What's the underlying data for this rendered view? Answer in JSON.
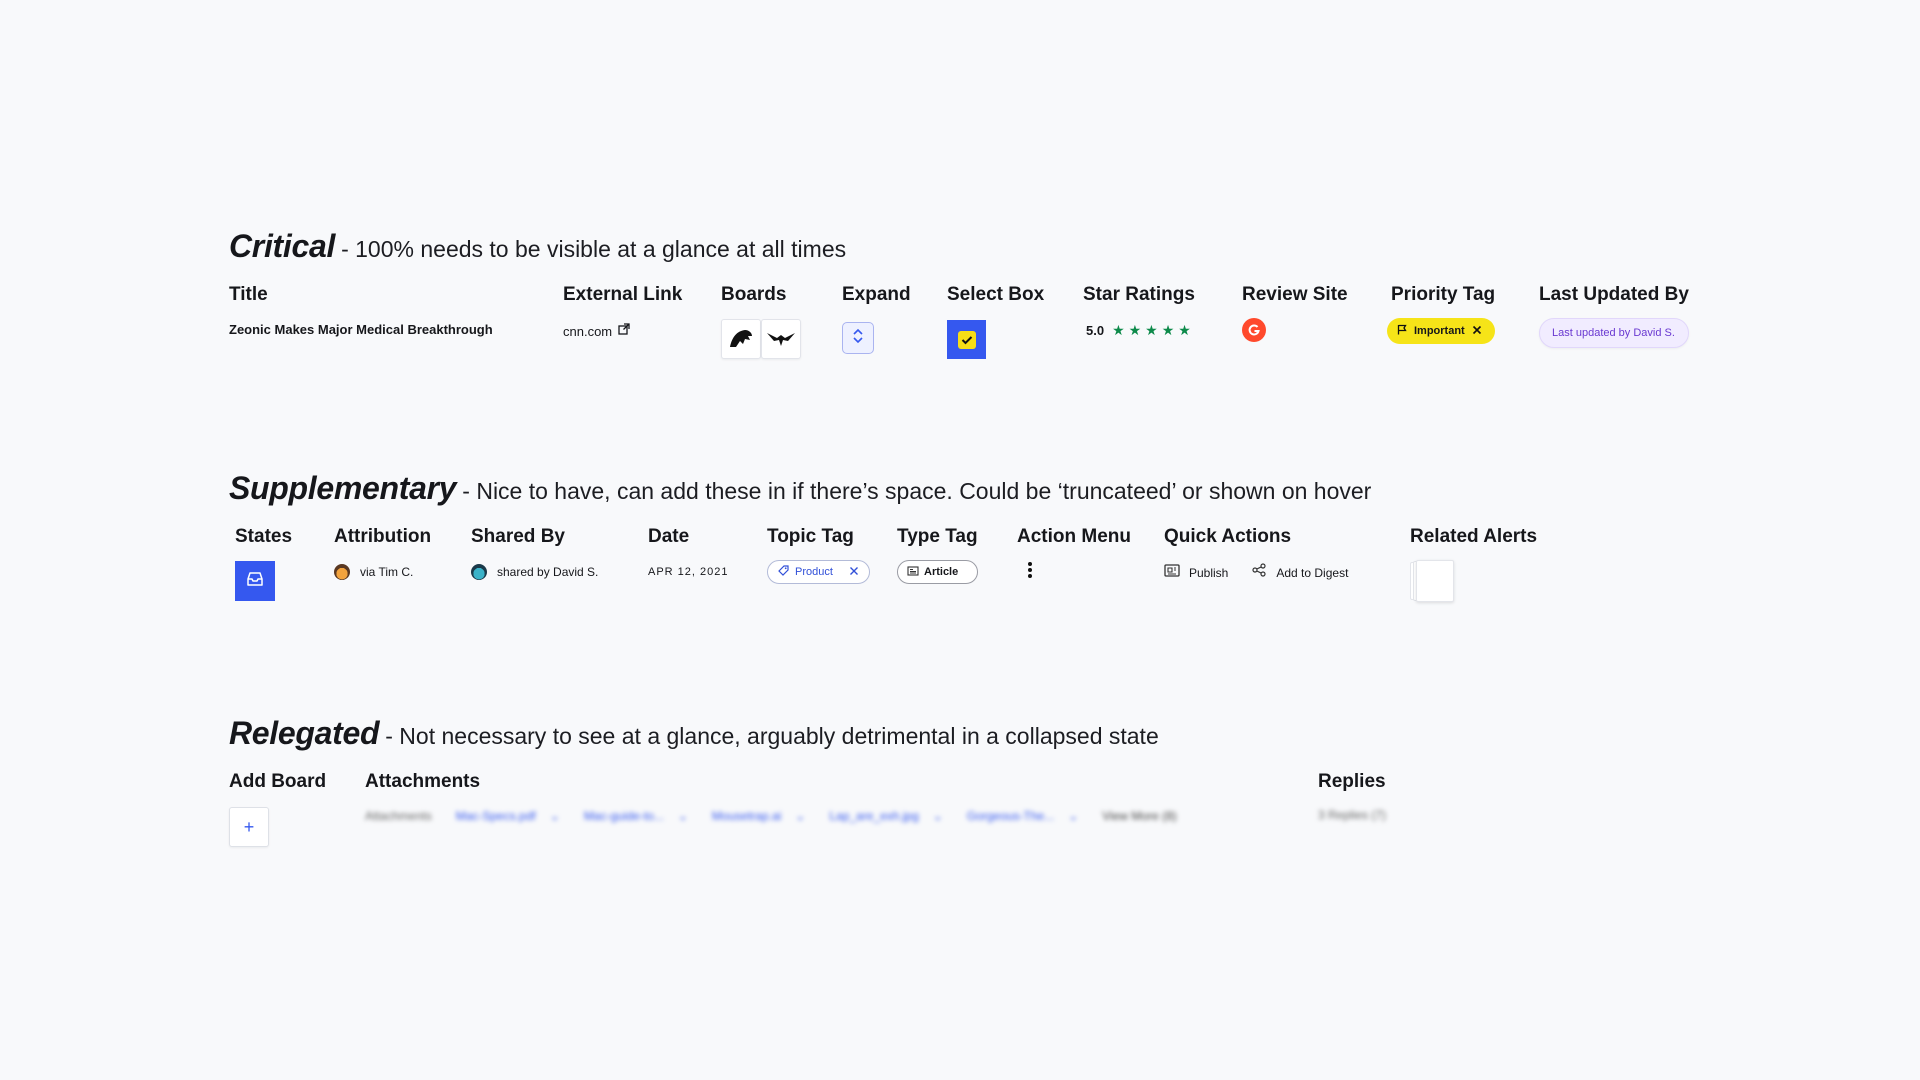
{
  "critical": {
    "title": "Critical",
    "description": "- 100% needs to be visible at a glance at all times",
    "columns": {
      "title": {
        "label": "Title",
        "value": "Zeonic Makes Major Medical Breakthrough"
      },
      "external_link": {
        "label": "External Link",
        "value": "cnn.com",
        "icon": "external-link-icon"
      },
      "boards": {
        "label": "Boards",
        "icons": [
          "lion-logo-icon",
          "eagle-logo-icon"
        ]
      },
      "expand": {
        "label": "Expand",
        "icon": "chevron-up-down-icon"
      },
      "select_box": {
        "label": "Select Box",
        "checked": true
      },
      "star_ratings": {
        "label": "Star Ratings",
        "value": "5.0",
        "stars": 5,
        "color": "#0d8a4a"
      },
      "review_site": {
        "label": "Review Site",
        "icon": "g2-logo-icon",
        "color": "#ff492c"
      },
      "priority_tag": {
        "label": "Priority Tag",
        "value": "Important",
        "color": "#f6e418"
      },
      "last_updated": {
        "label": "Last Updated By",
        "value": "Last updated by David S."
      }
    }
  },
  "supplementary": {
    "title": "Supplementary",
    "description": "- Nice to have, can add these in if there’s space. Could be ‘truncateed’ or shown on hover",
    "columns": {
      "states": {
        "label": "States",
        "icon": "inbox-icon"
      },
      "attribution": {
        "label": "Attribution",
        "value": "via Tim C."
      },
      "shared_by": {
        "label": "Shared By",
        "value": "shared by David S."
      },
      "date": {
        "label": "Date",
        "value": "APR 12, 2021"
      },
      "topic_tag": {
        "label": "Topic Tag",
        "value": "Product"
      },
      "type_tag": {
        "label": "Type Tag",
        "value": "Article"
      },
      "action_menu": {
        "label": "Action Menu",
        "icon": "vertical-dots-icon"
      },
      "quick_actions": {
        "label": "Quick Actions",
        "publish": "Publish",
        "add_to_digest": "Add to Digest"
      },
      "related_alerts": {
        "label": "Related Alerts"
      }
    }
  },
  "relegated": {
    "title": "Relegated",
    "description": "- Not necessary to see at a glance, arguably detrimental in a collapsed state",
    "columns": {
      "add_board": {
        "label": "Add Board",
        "symbol": "+"
      },
      "attachments": {
        "label": "Attachments",
        "prefix": "Attachments",
        "items": [
          "Mac-Specs.pdf",
          "Mac-guide-to...",
          "Mousetrap.ai",
          "Lap_are_exh.jpg",
          "Gorgeous-The..."
        ],
        "more": "View More (8)"
      },
      "replies": {
        "label": "Replies",
        "value": "3 Replies (7)"
      }
    }
  },
  "colors": {
    "accent": "#3558ef",
    "background": "#f8f9fb"
  }
}
